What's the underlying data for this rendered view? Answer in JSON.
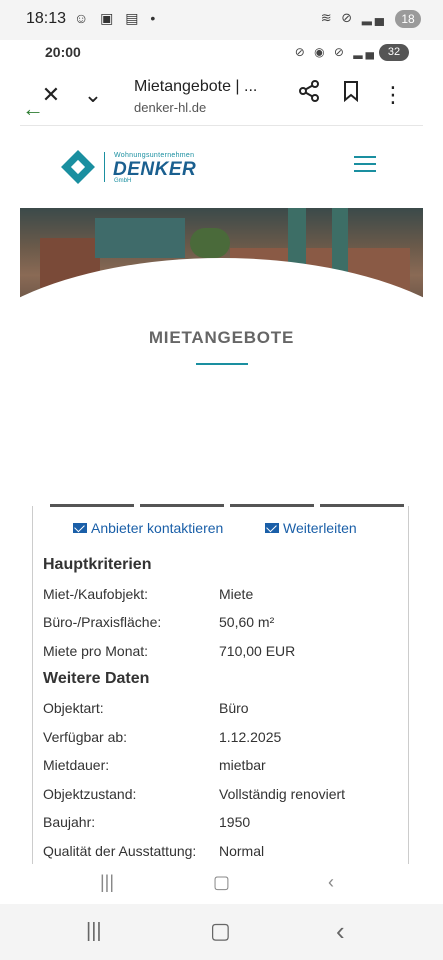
{
  "outer_status": {
    "time": "18:13",
    "battery": "18"
  },
  "inner_status": {
    "time": "20:00",
    "battery": "32"
  },
  "toolbar": {
    "title": "Mietangebote | ...",
    "url": "denker-hl.de"
  },
  "site": {
    "logo_tagline": "Wohnungsunternehmen",
    "logo_name": "DENKER",
    "logo_suffix": "GmbH"
  },
  "page": {
    "heading": "MIETANGEBOTE"
  },
  "actions": {
    "contact_label": "Anbieter kontaktieren",
    "forward_label": "Weiterleiten"
  },
  "main_criteria": {
    "title": "Hauptkriterien",
    "rows": [
      {
        "label": "Miet-/Kaufobjekt:",
        "value": "Miete"
      },
      {
        "label": "Büro-/Praxisfläche:",
        "value": "50,60 m²"
      },
      {
        "label": "Miete pro Monat:",
        "value": "710,00 EUR"
      }
    ]
  },
  "more_data": {
    "title": "Weitere Daten",
    "rows": [
      {
        "label": "Objektart:",
        "value": "Büro"
      },
      {
        "label": "Verfügbar ab:",
        "value": "1.12.2025"
      },
      {
        "label": "Mietdauer:",
        "value": "mietbar"
      },
      {
        "label": "Objektzustand:",
        "value": "Vollständig renoviert"
      },
      {
        "label": "Baujahr:",
        "value": "1950"
      },
      {
        "label": "Qualität der Ausstattung:",
        "value": "Normal"
      }
    ]
  },
  "colors": {
    "accent": "#1a8fa0",
    "link": "#1a5fa8",
    "brand": "#1a5f8f"
  }
}
